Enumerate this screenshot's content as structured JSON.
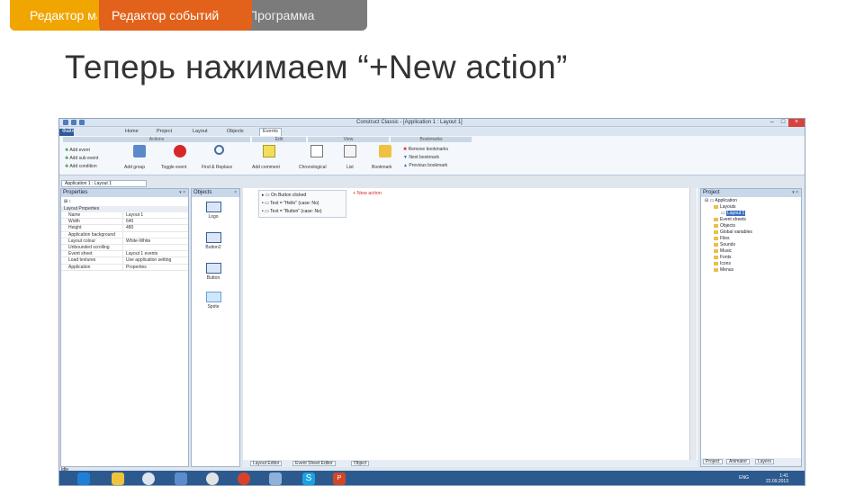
{
  "breadcrumbs": {
    "left": "Редактор макетов",
    "active": "Редактор событий",
    "right": "Программа"
  },
  "slide_title": "Теперь нажимаем “+New action”",
  "app": {
    "window_title": "Construct Classic - [Application 1 : Layout 1]",
    "menu_tabs": [
      "Файл",
      "Home",
      "Project",
      "Layout",
      "Objects",
      "Events"
    ],
    "ribbon": {
      "groups": [
        "Actions",
        "Edit",
        "View",
        "Bookmarks"
      ],
      "buttons": {
        "add_event": "Add event",
        "add_sub_event": "Add sub event",
        "add_condition": "Add condition",
        "add_group": "Add group",
        "toggle_event": "Toggle event",
        "find_replace": "Find & Replace",
        "add_comment": "Add comment",
        "chronological": "Chronological",
        "list": "List",
        "bookmark": "Bookmark",
        "remove_bookmarks": "Remove bookmarks",
        "next_bookmark": "Next bookmark",
        "previous_bookmark": "Previous bookmark"
      }
    },
    "document_tab": "Application 1 : Layout 1",
    "properties": {
      "header": "Properties",
      "group": "Layout Properties",
      "rows": [
        {
          "k": "Name",
          "v": "Layout 1"
        },
        {
          "k": "Width",
          "v": "640"
        },
        {
          "k": "Height",
          "v": "480"
        },
        {
          "k": "Application background",
          "v": ""
        },
        {
          "k": "Layout colour",
          "v": "White-White"
        },
        {
          "k": "Unbounded scrolling",
          "v": ""
        },
        {
          "k": "Event sheet",
          "v": "Layout 1 events"
        },
        {
          "k": "Load textures",
          "v": "Use application setting"
        },
        {
          "k": "Application",
          "v": "Properties"
        }
      ]
    },
    "objects": {
      "header": "Objects",
      "items": [
        "Logo",
        "Button2",
        "Button",
        "Sprite"
      ]
    },
    "events": {
      "lines": [
        "On Button clicked",
        "Text = \"Hello\" (case: No)",
        "Text = \"Button\" (case: No)"
      ],
      "new_action": "+ New action"
    },
    "bottom_tabs": [
      "Layout Editor",
      "Event Sheet Editor",
      "Object"
    ],
    "project": {
      "header": "Project",
      "tree": [
        "Application",
        "Layouts",
        "Layout 1",
        "Event sheets",
        "Objects",
        "Global variables",
        "Files",
        "Sounds",
        "Music",
        "Fonts",
        "Icons",
        "Menus"
      ],
      "bottom_tabs": [
        "Project",
        "Animator",
        "Layers"
      ]
    },
    "status": "Idle",
    "clock": {
      "time": "1:41",
      "date": "22.09.2013",
      "lang": "ENG"
    }
  }
}
